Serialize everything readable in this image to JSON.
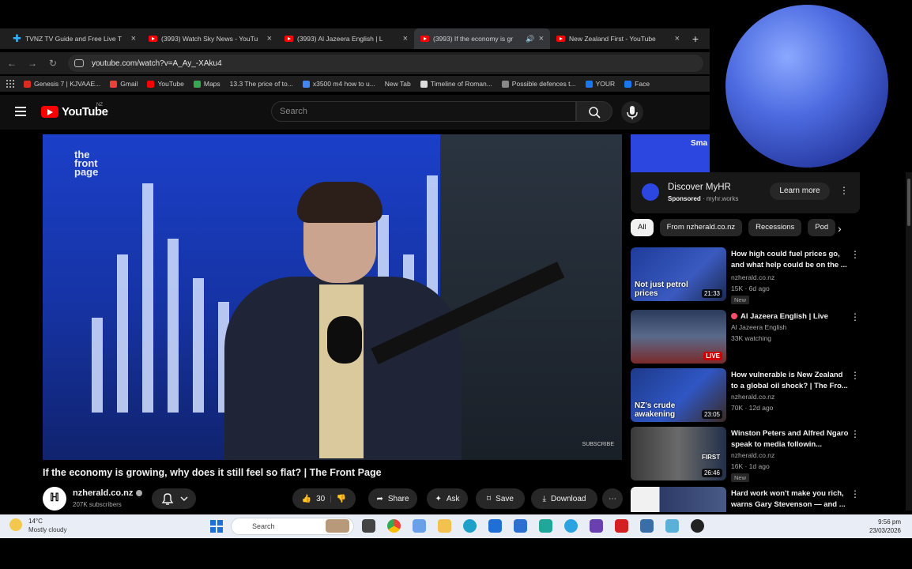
{
  "browser": {
    "tabs": [
      {
        "title": "TVNZ TV Guide and Free Live T",
        "icon": "tvnz-icon",
        "active": false
      },
      {
        "title": "(3993) Watch Sky News - YouTu",
        "icon": "youtube-icon",
        "active": false
      },
      {
        "title": "(3993) Al Jazeera English | L",
        "icon": "youtube-icon",
        "active": false
      },
      {
        "title": "(3993) If the economy is gr",
        "icon": "youtube-icon",
        "active": true
      },
      {
        "title": "New Zealand First - YouTube",
        "icon": "youtube-icon",
        "active": false
      }
    ],
    "url": "youtube.com/watch?v=A_Ay_-XAku4",
    "bookmarks": [
      {
        "label": "Genesis 7 | KJVAAE...",
        "color": "#d92d20"
      },
      {
        "label": "Gmail",
        "color": "#ea4335"
      },
      {
        "label": "YouTube",
        "color": "#ff0000"
      },
      {
        "label": "Maps",
        "color": "#34a853"
      },
      {
        "label": "13.3 The price of to...",
        "color": "#555555"
      },
      {
        "label": "x3500 m4 how to u...",
        "color": "#4285f4"
      },
      {
        "label": "New Tab",
        "color": "#555555"
      },
      {
        "label": "Timeline of Roman...",
        "color": "#dddddd"
      },
      {
        "label": "Possible defences t...",
        "color": "#888888"
      },
      {
        "label": "YOUR",
        "color": "#1877f2"
      },
      {
        "label": "Face",
        "color": "#1877f2"
      }
    ]
  },
  "youtube": {
    "logo_text": "YouTube",
    "region": "NZ",
    "search_placeholder": "Search"
  },
  "video": {
    "brand": "the front page",
    "overlay_text": "SUBSCRIBE",
    "title": "If the economy is growing, why does it still feel so flat? | The Front Page",
    "channel": "nzherald.co.nz",
    "subscribers": "207K subscribers",
    "likes": "30",
    "share_label": "Share",
    "ask_label": "Ask",
    "save_label": "Save",
    "download_label": "Download"
  },
  "ad": {
    "banner_text": "Sma Real HR c",
    "title": "Discover MyHR",
    "sponsored": "Sponsored",
    "domain": "myhr.works",
    "cta": "Learn more"
  },
  "chips": [
    "All",
    "From nzherald.co.nz",
    "Recessions",
    "Pod"
  ],
  "recommendations": [
    {
      "title": "How high could fuel prices go, and what help could be on the ...",
      "channel": "nzherald.co.nz",
      "meta": "15K · 6d ago",
      "badge": "New",
      "duration": "21:33",
      "caption": "Not just petrol prices"
    },
    {
      "title": "Al Jazeera English | Live",
      "channel": "Al Jazeera English",
      "meta": "33K watching",
      "live_label": "LIVE"
    },
    {
      "title": "How vulnerable is New Zealand to a global oil shock? | The Fro...",
      "channel": "nzherald.co.nz",
      "meta": "70K · 12d ago",
      "duration": "23:05",
      "caption": "NZ's crude awakening"
    },
    {
      "title": "Winston Peters and Alfred Ngaro speak to media followin...",
      "channel": "nzherald.co.nz",
      "meta": "16K · 1d ago",
      "badge": "New",
      "duration": "26:46",
      "caption": "FIRST"
    },
    {
      "title": "Hard work won't make you rich, warns Gary Stevenson — and ..."
    }
  ],
  "taskbar": {
    "temperature": "14°C",
    "condition": "Mostly cloudy",
    "search_placeholder": "Search",
    "time": "9:56 pm",
    "date": "23/03/2026"
  }
}
